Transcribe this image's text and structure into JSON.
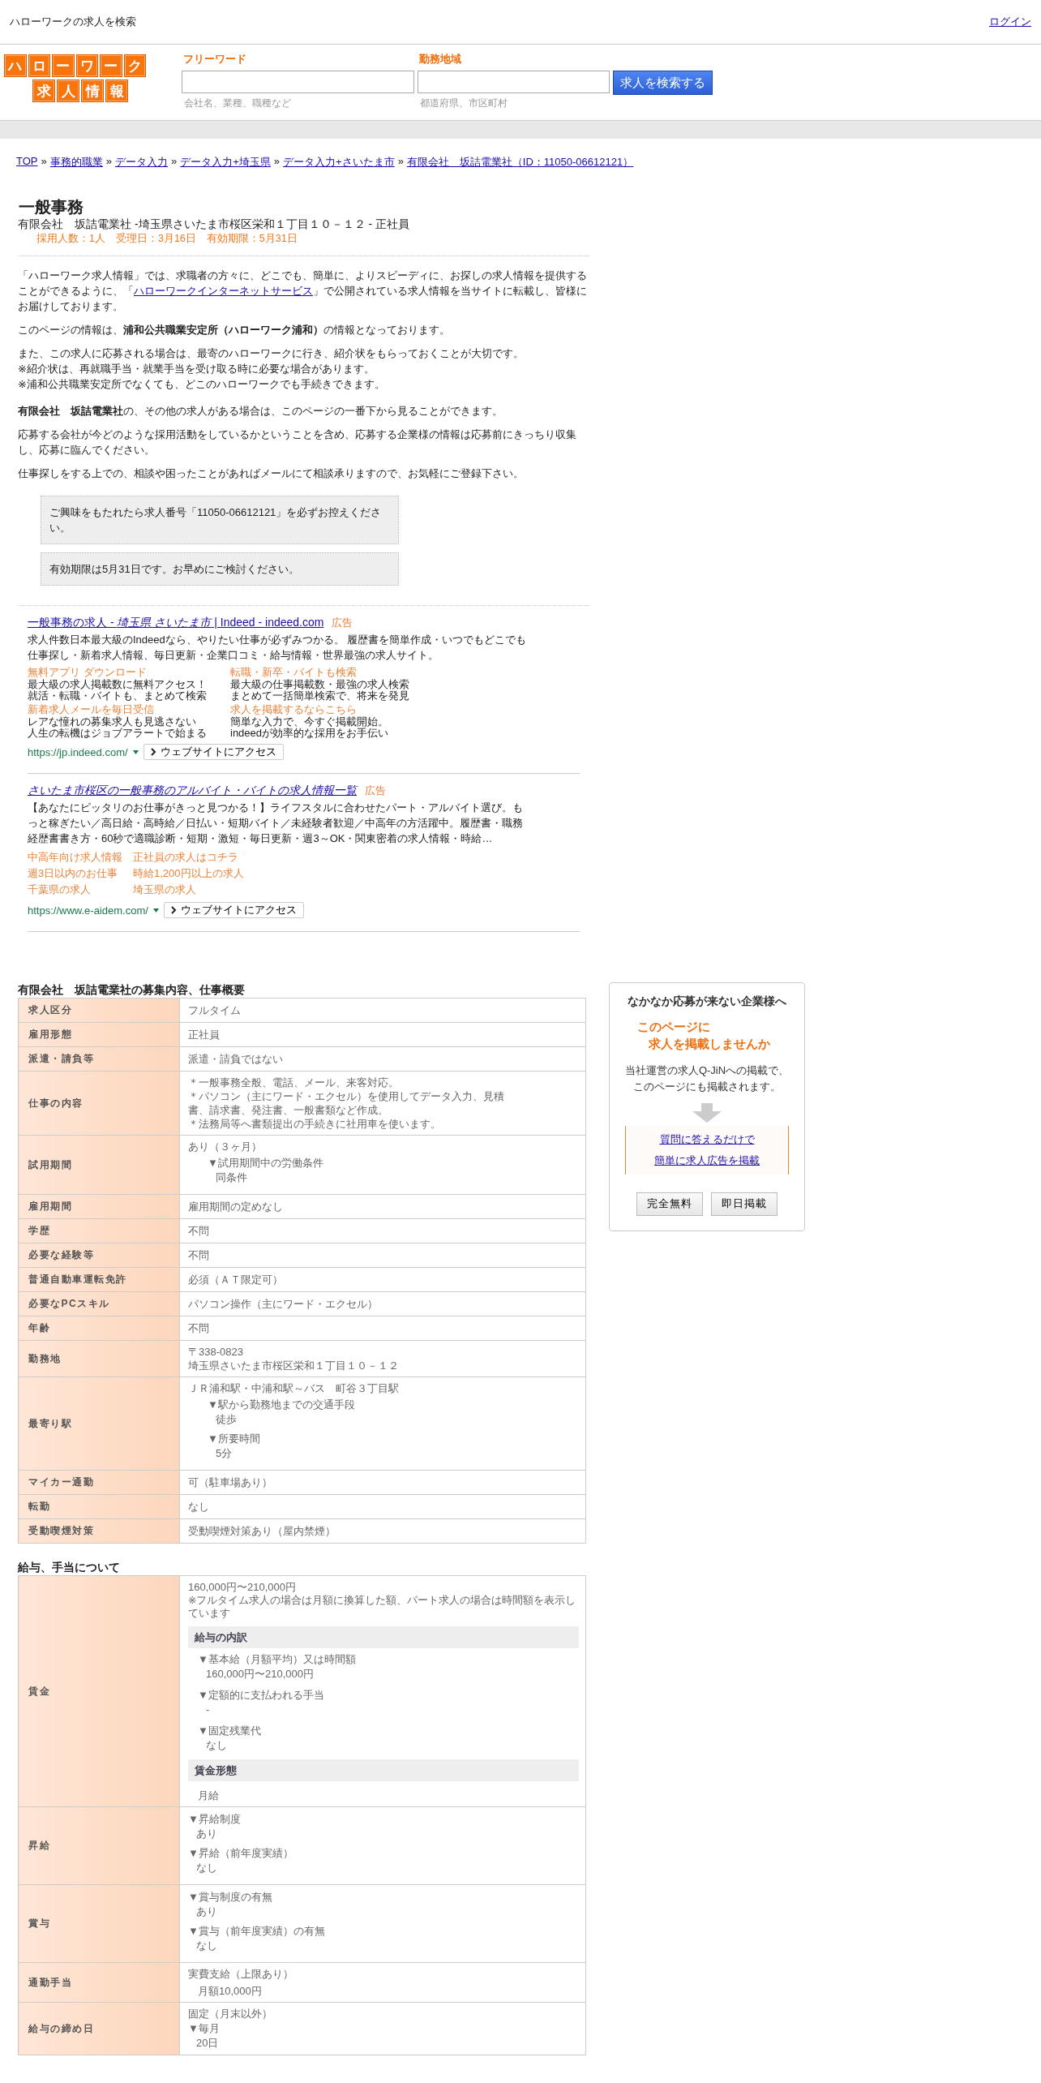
{
  "header": {
    "title": "ハローワークの求人を検索",
    "login": "ログイン"
  },
  "logo": {
    "row_1": "ハローワーク",
    "row_2": "求人情報"
  },
  "search": {
    "fields": [
      {
        "label": "フリーワード",
        "placeholder": "会社名、業種、職種など"
      },
      {
        "label": "勤務地域",
        "placeholder": "都道府県、市区町村"
      }
    ],
    "button": "求人を検索する"
  },
  "breadcrumb": [
    "TOP",
    "事務的職業",
    "データ入力",
    "データ入力+埼玉県",
    "データ入力+さいたま市",
    "有限会社　坂詰電業社（ID：11050-06612121）"
  ],
  "breadcrumb_separator": "»",
  "job": {
    "title": "一般事務",
    "subtitle": "有限会社　坂詰電業社 -埼玉県さいたま市桜区栄和１丁目１０－１２ - 正社員",
    "meta": "採用人数：1人　受理日：3月16日　有効期限：5月31日"
  },
  "intro": {
    "lead": {
      "before": "「ハローワーク求人情報」では、求職者の方々に、どこでも、簡単に、よりスピーディに、お探しの求人情報を提供することができるように、「",
      "link": "ハローワークインターネットサービス",
      "after": "」で公開されている求人情報を当サイトに転載し、皆様にお届けしております。"
    },
    "groups": [
      [
        {
          "lines": [
            "このページの情報は、**浦和公共職業安定所（ハローワーク浦和）**の情報となっております。"
          ]
        },
        {
          "lines": [
            "また、この求人に応募される場合は、最寄のハローワークに行き、紹介状をもらっておくことが大切です。",
            "※紹介状は、再就職手当・就業手当を受け取る時に必要な場合があります。",
            "※浦和公共職業安定所でなくても、どこのハローワークでも手続きできます。"
          ]
        }
      ],
      [
        {
          "lines": [
            "**有限会社　坂詰電業社**の、その他の求人がある場合は、このページの一番下から見ることができます。"
          ]
        },
        {
          "lines": [
            "応募する会社が今どのような採用活動をしているかということを含め、応募する企業様の情報は応募前にきっちり収集し、応募に臨んでください。"
          ]
        },
        {
          "lines": [
            "仕事探しをする上での、相談や困ったことがあればメールにて相談承りますので、お気軽にご登録下さい。"
          ]
        }
      ]
    ]
  },
  "notices": [
    "ご興味をもたれたら求人番号「11050-06612121」を必ずお控えください。",
    "有効期限は5月31日です。お早めにご検討ください。"
  ],
  "ads": [
    {
      "kind": "detailed",
      "title": "一般事務の求人 - *埼玉県 さいたま市* | Indeed - indeed.com",
      "label": "広告",
      "description": "求人件数日本最大級のIndeedなら、やりたい仕事が必ずみつかる。 履歴書を簡単作成・いつでもどこでも仕事探し・新着求人情報、毎日更新・企業口コミ・給与情報・世界最強の求人サイト。",
      "sitelinks": [
        {
          "title": "無料アプリ ダウンロード",
          "lines": [
            "最大級の求人掲載数に無料アクセス！",
            "就活・転職・バイトも、まとめて検索"
          ]
        },
        {
          "title": "転職・新卒・バイトも検索",
          "lines": [
            "最大級の仕事掲載数・最強の求人検索",
            "まとめて一括簡単検索で、将来を発見"
          ]
        },
        {
          "title": "新着求人メールを毎日受信",
          "lines": [
            "レアな憧れの募集求人も見逃さない",
            "人生の転機はジョブアラートで始まる"
          ]
        },
        {
          "title": "求人を掲載するならこちら",
          "lines": [
            "簡単な入力で、今すぐ掲載開始。",
            "indeedが効率的な採用をお手伝い"
          ]
        }
      ],
      "url": "https://jp.indeed.com/",
      "visit": "ウェブサイトにアクセス"
    },
    {
      "kind": "simple",
      "title": "*さいたま市桜区の一般事務のアルバイト・バイトの求人情報一覧*",
      "label": "広告",
      "description": "【あなたにピッタリのお仕事がきっと見つかる！】ライフスタルに合わせたパート・アルバイト選び。もっと稼ぎたい／高日給・高時給／日払い・短期バイト／未経験者歓迎／中高年の方活躍中。履歴書・職務経歴書書き方・60秒で適職診断・短期・激短・毎日更新・週3～OK・関東密着の求人情報・時給…",
      "sitelinks": [
        {
          "title": "中高年向け求人情報"
        },
        {
          "title": "正社員の求人はコチラ"
        },
        {
          "title": "週3日以内のお仕事"
        },
        {
          "title": "時給1,200円以上の求人"
        },
        {
          "title": "千葉県の求人"
        },
        {
          "title": "埼玉県の求人"
        }
      ],
      "url": "https://www.e-aidem.com/",
      "visit": "ウェブサイトにアクセス"
    }
  ],
  "sections": [
    {
      "title": "有限会社　坂詰電業社の募集内容、仕事概要",
      "rows": [
        {
          "label": "求人区分",
          "blocks": [
            {
              "kind": "text",
              "text": "フルタイム"
            }
          ]
        },
        {
          "label": "雇用形態",
          "blocks": [
            {
              "kind": "text",
              "text": "正社員"
            }
          ]
        },
        {
          "label": "派遣・請負等",
          "blocks": [
            {
              "kind": "text",
              "text": "派遣・請負ではない"
            }
          ]
        },
        {
          "label": "仕事の内容",
          "blocks": [
            {
              "kind": "text",
              "text": "＊一般事務全般、電話、メール、来客対応。"
            },
            {
              "kind": "text",
              "text": "＊パソコン（主にワード・エクセル）を使用してデータ入力、見積"
            },
            {
              "kind": "text",
              "text": "書、請求書、発注書、一般書類など作成。"
            },
            {
              "kind": "text",
              "text": "＊法務局等へ書類提出の手続きに社用車を使います。"
            }
          ]
        },
        {
          "label": "試用期間",
          "blocks": [
            {
              "kind": "text",
              "text": "あり（３ヶ月）"
            },
            {
              "kind": "item",
              "heading": "▼試用期間中の労働条件",
              "value": "同条件"
            }
          ]
        },
        {
          "label": "雇用期間",
          "blocks": [
            {
              "kind": "text",
              "text": "雇用期間の定めなし"
            }
          ]
        },
        {
          "label": "学歴",
          "blocks": [
            {
              "kind": "text",
              "text": "不問"
            }
          ]
        },
        {
          "label": "必要な経験等",
          "blocks": [
            {
              "kind": "text",
              "text": "不問"
            }
          ]
        },
        {
          "label": "普通自動車運転免許",
          "blocks": [
            {
              "kind": "text",
              "text": "必須（ＡＴ限定可）"
            }
          ]
        },
        {
          "label": "必要なPCスキル",
          "blocks": [
            {
              "kind": "text",
              "text": "パソコン操作（主にワード・エクセル）"
            }
          ]
        },
        {
          "label": "年齢",
          "blocks": [
            {
              "kind": "text",
              "text": "不問"
            }
          ]
        },
        {
          "label": "勤務地",
          "blocks": [
            {
              "kind": "text",
              "text": "〒338-0823"
            },
            {
              "kind": "text",
              "text": "埼玉県さいたま市桜区栄和１丁目１０－１２"
            }
          ]
        },
        {
          "label": "最寄り駅",
          "blocks": [
            {
              "kind": "text",
              "text": "ＪＲ浦和駅・中浦和駅～バス　町谷３丁目駅"
            },
            {
              "kind": "item",
              "heading": "▼駅から勤務地までの交通手段",
              "value": "徒歩"
            },
            {
              "kind": "item",
              "heading": "▼所要時間",
              "value": "5分"
            }
          ]
        },
        {
          "label": "マイカー通勤",
          "blocks": [
            {
              "kind": "text",
              "text": "可（駐車場あり）"
            }
          ]
        },
        {
          "label": "転勤",
          "blocks": [
            {
              "kind": "text",
              "text": "なし"
            }
          ]
        },
        {
          "label": "受動喫煙対策",
          "blocks": [
            {
              "kind": "text",
              "text": "受動喫煙対策あり（屋内禁煙）"
            }
          ]
        }
      ]
    },
    {
      "title": "給与、手当について",
      "rows": [
        {
          "label": "賃金",
          "blocks": [
            {
              "kind": "text",
              "text": "160,000円〜210,000円"
            },
            {
              "kind": "note",
              "text": "※フルタイム求人の場合は月額に換算した額、パート求人の場合は時間額を表示しています"
            },
            {
              "kind": "subhead",
              "text": "給与の内訳"
            },
            {
              "kind": "subitem",
              "heading": "▼基本給（月額平均）又は時間額",
              "value": "160,000円〜210,000円"
            },
            {
              "kind": "subitem",
              "heading": "▼定額的に支払われる手当",
              "value": "-"
            },
            {
              "kind": "subitem",
              "heading": "▼固定残業代",
              "value": "なし"
            },
            {
              "kind": "subhead",
              "text": "賃金形態"
            },
            {
              "kind": "indent",
              "text": "月給"
            }
          ]
        },
        {
          "label": "昇給",
          "blocks": [
            {
              "kind": "flat",
              "heading": "▼昇給制度",
              "value": "あり"
            },
            {
              "kind": "flat",
              "heading": "▼昇給（前年度実績）",
              "value": "なし"
            }
          ]
        },
        {
          "label": "賞与",
          "blocks": [
            {
              "kind": "flat",
              "heading": "▼賞与制度の有無",
              "value": "あり"
            },
            {
              "kind": "flat",
              "heading": "▼賞与（前年度実績）の有無",
              "value": "なし"
            }
          ]
        },
        {
          "label": "通勤手当",
          "blocks": [
            {
              "kind": "text",
              "text": "実費支給（上限あり）"
            },
            {
              "kind": "indent",
              "text": "月額10,000円"
            }
          ]
        },
        {
          "label": "給与の締め日",
          "blocks": [
            {
              "kind": "text",
              "text": "固定（月末以外）"
            },
            {
              "kind": "tight",
              "heading": "▼毎月",
              "value": "20日"
            }
          ]
        }
      ]
    }
  ],
  "sidebar": {
    "title": "なかなか応募が来ない企業様へ",
    "catch": [
      "このページに",
      "求人を掲載しませんか"
    ],
    "description": [
      "当社運営の求人Q-JiNへの掲載で、",
      "このページにも掲載されます。"
    ],
    "links": [
      "質問に答えるだけで",
      "簡単に求人広告を掲載"
    ],
    "buttons": [
      "完全無料",
      "即日掲載"
    ]
  }
}
